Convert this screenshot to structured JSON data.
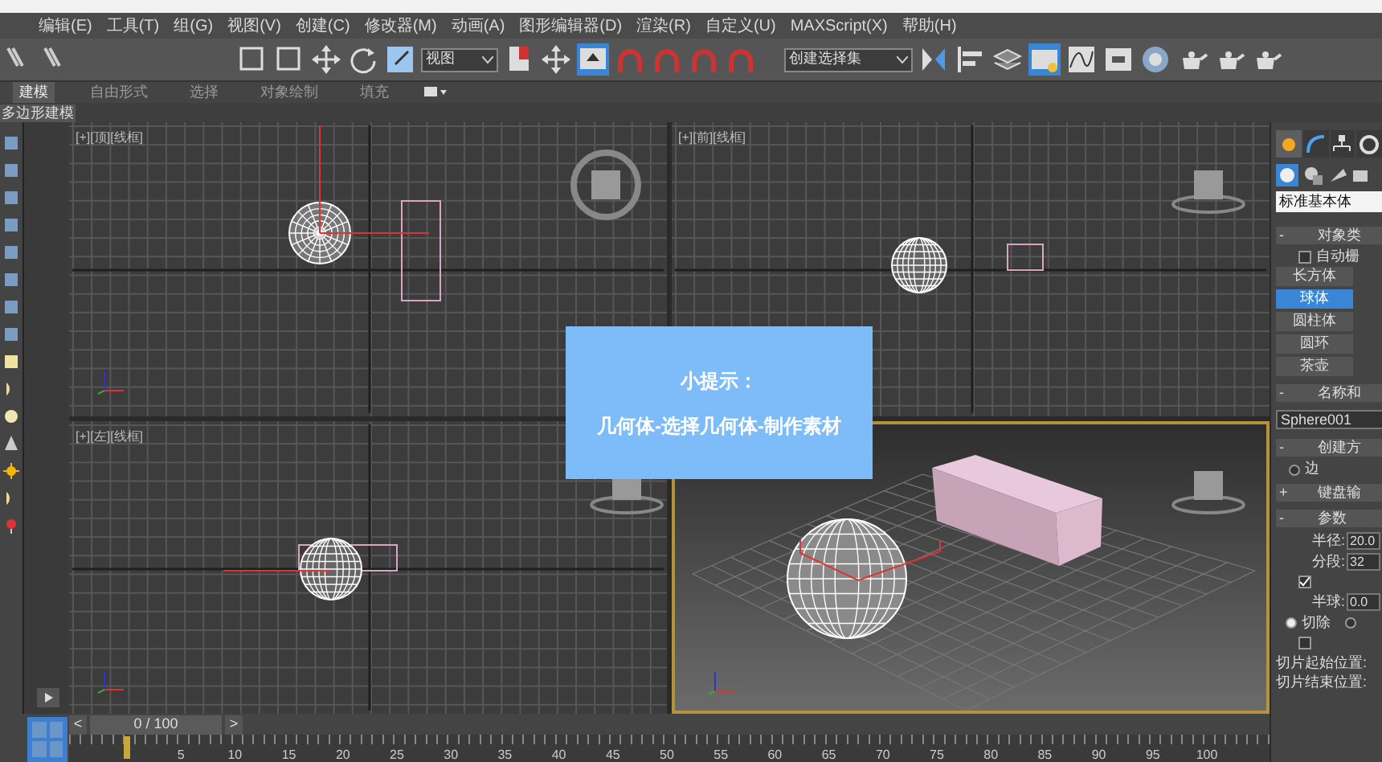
{
  "menu": [
    "编辑(E)",
    "工具(T)",
    "组(G)",
    "视图(V)",
    "创建(C)",
    "修改器(M)",
    "动画(A)",
    "图形编辑器(D)",
    "渲染(R)",
    "自定义(U)",
    "MAXScript(X)",
    "帮助(H)"
  ],
  "toolbar": {
    "view_dropdown": "视图",
    "selection_set_dropdown": "创建选择集"
  },
  "ribbon_tabs": [
    {
      "label": "建模",
      "selected": true
    },
    {
      "label": "自由形式",
      "selected": false
    },
    {
      "label": "选择",
      "selected": false
    },
    {
      "label": "对象绘制",
      "selected": false
    },
    {
      "label": "填充",
      "selected": false
    }
  ],
  "ribbon_panel_label": "多边形建模",
  "viewports": [
    {
      "kind": "top",
      "label": "[+][顶][线框]",
      "selected": false
    },
    {
      "kind": "front",
      "label": "[+][前][线框]",
      "selected": false
    },
    {
      "kind": "left",
      "label": "[+][左][线框]",
      "selected": false
    },
    {
      "kind": "perspective",
      "selected": true
    }
  ],
  "tip": {
    "title": "小提示：",
    "text": "几何体-选择几何体-制作素材"
  },
  "time_slider": {
    "prev": "<",
    "frame": "0 / 100",
    "next": ">"
  },
  "timeline": {
    "labels": [
      "5",
      "10",
      "15",
      "20",
      "25",
      "30",
      "35",
      "40",
      "45",
      "50",
      "55",
      "60",
      "65",
      "70",
      "75",
      "80",
      "85",
      "90",
      "95",
      "100"
    ]
  },
  "command_panel": {
    "tabs": [
      {
        "selected": true
      },
      {
        "selected": false
      },
      {
        "selected": false
      },
      {
        "selected": false
      }
    ],
    "category": "标准基本体",
    "object_type": {
      "toggle": "-",
      "title": "对象类",
      "auto_grid": {
        "label": "自动栅",
        "checked": false
      },
      "buttons": [
        {
          "label": "长方体",
          "selected": false
        },
        {
          "label": "球体",
          "selected": true
        },
        {
          "label": "圆柱体",
          "selected": false
        },
        {
          "label": "圆环",
          "selected": false
        },
        {
          "label": "茶壶",
          "selected": false
        }
      ]
    },
    "name_color": {
      "toggle": "-",
      "title": "名称和",
      "name": "Sphere001"
    },
    "creation_method": {
      "toggle": "-",
      "title": "创建方",
      "option": {
        "label": "边",
        "selected": false
      }
    },
    "keyboard_entry": {
      "toggle": "+",
      "title": "键盘输"
    },
    "parameters": {
      "toggle": "-",
      "title": "参数",
      "fields": [
        {
          "label": "半径:",
          "value": "20.0"
        },
        {
          "label": "分段:",
          "value": "32"
        }
      ],
      "smooth": {
        "checked": true
      },
      "hemisphere": {
        "label": "半球:",
        "value": "0.0"
      },
      "options": [
        {
          "label": "切除",
          "selected": true
        },
        {
          "selected": false
        }
      ],
      "slice_on": {
        "checked": false
      },
      "slice_from": "切片起始位置:",
      "slice_to": "切片结束位置:"
    }
  }
}
